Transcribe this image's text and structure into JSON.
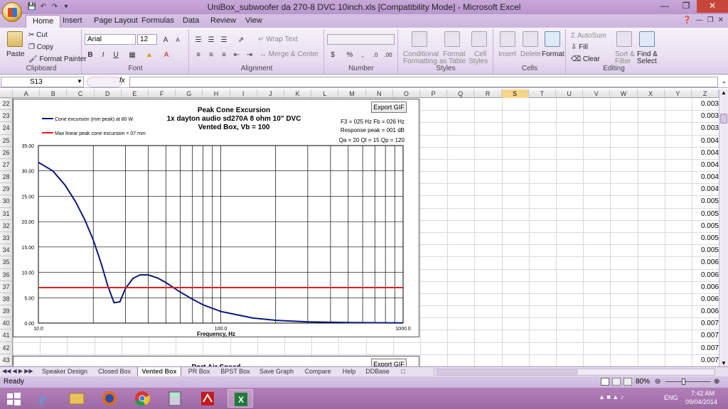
{
  "window": {
    "title": "UniBox_subwoofer da 270-8 DVC 10inch.xls  [Compatibility Mode]  -  Microsoft Excel"
  },
  "ribbon_tabs": [
    "Home",
    "Insert",
    "Page Layout",
    "Formulas",
    "Data",
    "Review",
    "View"
  ],
  "clipboard": {
    "paste": "Paste",
    "cut": "Cut",
    "copy": "Copy",
    "format_painter": "Format Painter",
    "label": "Clipboard"
  },
  "font": {
    "name": "Arial",
    "size": "12",
    "label": "Font",
    "bold": "B",
    "italic": "I",
    "underline": "U"
  },
  "alignment": {
    "wrap": "Wrap Text",
    "merge": "Merge & Center",
    "label": "Alignment"
  },
  "number": {
    "format": "",
    "label": "Number",
    "currency": "$",
    "percent": "%",
    "comma": ","
  },
  "styles": {
    "cond": "Conditional",
    "cond2": "Formatting",
    "fmt": "Format",
    "fmt2": "as Table",
    "cell": "Cell",
    "cell2": "Styles",
    "label": "Styles"
  },
  "cells": {
    "insert": "Insert",
    "delete": "Delete",
    "format": "Format",
    "label": "Cells"
  },
  "editing": {
    "autosum": "AutoSum",
    "fill": "Fill",
    "clear": "Clear",
    "sort": "Sort &",
    "sort2": "Filter",
    "find": "Find &",
    "find2": "Select",
    "label": "Editing"
  },
  "formula_bar": {
    "name_box": "S13",
    "fx": "fx",
    "value": ""
  },
  "columns": [
    "A",
    "B",
    "C",
    "D",
    "E",
    "F",
    "G",
    "H",
    "I",
    "J",
    "K",
    "L",
    "M",
    "N",
    "O",
    "P",
    "Q",
    "R",
    "S",
    "T",
    "U",
    "V",
    "W",
    "X",
    "Y",
    "Z"
  ],
  "selected_column": "S",
  "rows": [
    {
      "n": "22",
      "z": "0.003"
    },
    {
      "n": "23",
      "z": "0.003"
    },
    {
      "n": "24",
      "z": "0.003"
    },
    {
      "n": "25",
      "z": "0.004"
    },
    {
      "n": "26",
      "z": "0.004"
    },
    {
      "n": "27",
      "z": "0.004"
    },
    {
      "n": "28",
      "z": "0.004"
    },
    {
      "n": "29",
      "z": "0.004"
    },
    {
      "n": "30",
      "z": "0.005"
    },
    {
      "n": "31",
      "z": "0.005"
    },
    {
      "n": "32",
      "z": "0.005"
    },
    {
      "n": "33",
      "z": "0.005"
    },
    {
      "n": "34",
      "z": "0.005"
    },
    {
      "n": "35",
      "z": "0.006"
    },
    {
      "n": "36",
      "z": "0.006"
    },
    {
      "n": "37",
      "z": "0.006"
    },
    {
      "n": "38",
      "z": "0.006"
    },
    {
      "n": "39",
      "z": "0.006"
    },
    {
      "n": "40",
      "z": "0.007"
    },
    {
      "n": "41",
      "z": "0.007"
    },
    {
      "n": "42",
      "z": "0.007"
    },
    {
      "n": "43",
      "z": "0.007"
    }
  ],
  "chart1": {
    "export": "Export GIF",
    "title1": "Peak Cone Excursion",
    "title2": "1x dayton audio sd270A 8 ohm  10\" DVC",
    "title3": "Vented Box, Vb = 100",
    "legend1": "Cone excursion (mm peak) at 80 W",
    "legend2": "Max linear peak cone excursion = 07 mm",
    "info1": "F3 = 025 Hz  Fb = 026 Hz",
    "info2": "Response peak = 001 dB",
    "info3": "Qa = 20  Ql = 15  Qp = 120",
    "xlabel": "Frequency, Hz",
    "yticks": [
      "35.00",
      "30.00",
      "25.00",
      "20.00",
      "15.00",
      "10.00",
      "5.00",
      "0.00"
    ],
    "xticks": [
      "10.0",
      "100.0",
      "1000.0"
    ]
  },
  "chart2": {
    "title": "Port Air Speed",
    "export": "Export GIF"
  },
  "chart_data": {
    "type": "line",
    "title": "Peak Cone Excursion",
    "subtitle": "1x dayton audio sd270A 8 ohm  10\" DVC  Vented Box, Vb = 100",
    "xlabel": "Frequency, Hz",
    "ylabel": "",
    "xscale": "log",
    "xlim": [
      10,
      1000
    ],
    "ylim": [
      0,
      35
    ],
    "grid": true,
    "series": [
      {
        "name": "Cone excursion (mm peak) at 80 W",
        "color": "#0b1a7a",
        "x": [
          10,
          12,
          14,
          16,
          18,
          20,
          22,
          24,
          26,
          28,
          30,
          33,
          36,
          40,
          45,
          50,
          60,
          70,
          80,
          100,
          150,
          200,
          300,
          500,
          1000
        ],
        "y": [
          31.7,
          30.0,
          27.2,
          23.9,
          20.3,
          16.4,
          12.0,
          7.4,
          4.0,
          4.2,
          6.8,
          8.8,
          9.5,
          9.5,
          8.9,
          8.0,
          6.1,
          4.7,
          3.6,
          2.3,
          1.0,
          0.55,
          0.25,
          0.1,
          0.03
        ]
      },
      {
        "name": "Max linear peak cone excursion = 07 mm",
        "color": "#e02020",
        "x": [
          10,
          1000
        ],
        "y": [
          7,
          7
        ]
      }
    ]
  },
  "sheet_tabs": [
    "Speaker Design",
    "Closed Box",
    "Vented Box",
    "PR Box",
    "BPST Box",
    "Save Graph",
    "Compare",
    "Help",
    "DDBase"
  ],
  "active_sheet": "Vented Box",
  "status": {
    "ready": "Ready",
    "zoom": "80%"
  },
  "taskbar": {
    "lang": "ENG",
    "time": "7:42 AM",
    "date": "09/04/2014"
  }
}
